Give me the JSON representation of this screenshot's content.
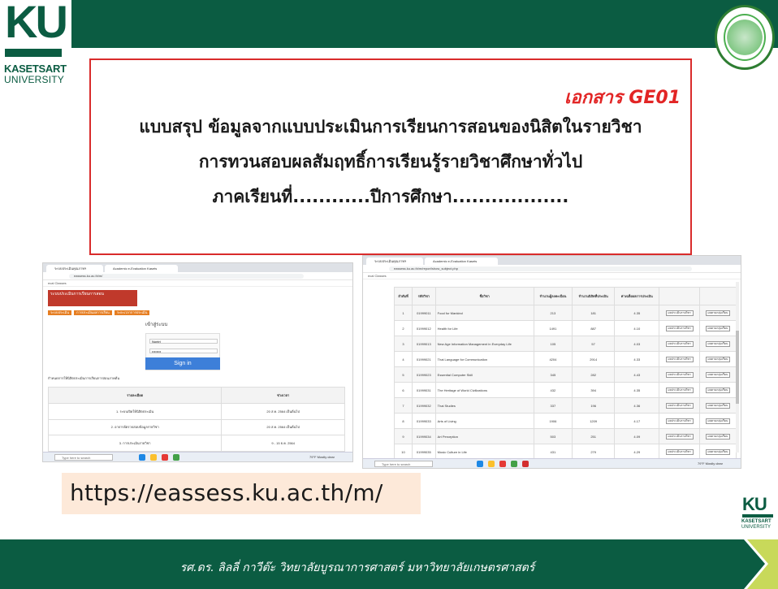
{
  "logo": {
    "letters": "KU",
    "line1": "KASETSART",
    "line2": "UNIVERSITY"
  },
  "title_box": {
    "doc_code": "เอกสาร GE01",
    "line1": "แบบสรุป ข้อมูลจากแบบประเมินการเรียนการสอนของนิสิตในรายวิชา",
    "line2": "การทวนสอบผลสัมฤทธิ์การเรียนรู้รายวิชาศึกษาทั่วไป",
    "line3": "ภาคเรียนที่............ปีการศึกษา.................."
  },
  "left_browser": {
    "tab1": "ระบบประเมินคุณภาพฯ",
    "tab2": "Academic e-Evaluation Kasets",
    "url": "eassess.ku.ac.th/m/",
    "bookmarks": "ecal   Classes",
    "site_head": "ระบบประเมินการเรียนการสอน",
    "menu": [
      "ระบบประเมิน",
      "การประเมินผลการเรียน",
      "ระยะเวลาการประเมิน"
    ],
    "login_title": "เข้าสู่ระบบ",
    "field_user": "Nontri",
    "field_pass": "••••••••",
    "signin_label": "Sign in",
    "schedule_title": "กำหนดการให้นิสิตประเมินการเรียนการสอนภาคต้น",
    "schedule_header": [
      "รายละเอียด",
      "ช่วงเวลา"
    ],
    "schedule_rows": [
      [
        "1. ระบบเปิดให้นิสิตประเมิน",
        "20 ส.ค. 2564 เป็นต้นไป"
      ],
      [
        "2. อาจารย์ตรวจสอบข้อมูลรายวิชา",
        "20 ส.ค. 2564 เป็นต้นไป"
      ],
      [
        "3. การประเมินรายวิชา",
        "9 - 15 ธ.ค. 2564"
      ]
    ],
    "search_placeholder": "Type here to search",
    "weather": "79°F Mostly clear"
  },
  "right_browser": {
    "tab1": "ระบบประเมินคุณภาพฯ",
    "tab2": "Academic e-Evaluation Kasets",
    "url": "eassess.ku.ac.th/m/report/show_subject.php",
    "bookmarks": "ecal   Classes",
    "table_header": [
      "ลำดับที่",
      "รหัสวิชา",
      "ชื่อวิชา",
      "จำนวนผู้ลงทะเบียน",
      "จำนวนนิสิตที่ประเมิน",
      "ค่าเฉลี่ยผลการประเมิน",
      "",
      ""
    ],
    "rows": [
      [
        "1",
        "01999011",
        "Food for Mankind",
        "213",
        "181",
        "4.35"
      ],
      [
        "2",
        "01999012",
        "Health for Life",
        "1491",
        "887",
        "4.10"
      ],
      [
        "3",
        "01999013",
        "New Age Information Management in Everyday Life",
        "105",
        "57",
        "4.03"
      ],
      [
        "4",
        "01999021",
        "Thai Language for Communication",
        "4204",
        "2914",
        "4.33"
      ],
      [
        "5",
        "01999023",
        "Essential Computer Skill",
        "345",
        "282",
        "4.43"
      ],
      [
        "6",
        "01999031",
        "The Heritage of World Civilizations",
        "432",
        "394",
        "4.35"
      ],
      [
        "7",
        "01999032",
        "Thai Studies",
        "337",
        "196",
        "4.36"
      ],
      [
        "8",
        "01999033",
        "Arts of Living",
        "1906",
        "1209",
        "4.17"
      ],
      [
        "9",
        "01999034",
        "Art Perception",
        "503",
        "251",
        "4.09"
      ],
      [
        "10",
        "01999035",
        "Music Culture in Life",
        "431",
        "279",
        "4.29"
      ]
    ],
    "btn1": "ผลประเมินรายวิชา",
    "btn2": "ผลตามกลุ่มเรียน",
    "search_placeholder": "Type here to search",
    "weather": "79°F Mostly clear"
  },
  "url_box": {
    "text": "https://eassess.ku.ac.th/m/"
  },
  "footer": {
    "text": "รศ.ดร. ลิลลี่ กาวีต๊ะ วิทยาลัยบูรณาการศาสตร์  มหาวิทยาลัยเกษตรศาสตร์"
  },
  "colors": {
    "brand_green": "#0b5c42",
    "title_border": "#d92b2b",
    "doc_code": "#e22525",
    "url_bg": "#fde9d9"
  }
}
